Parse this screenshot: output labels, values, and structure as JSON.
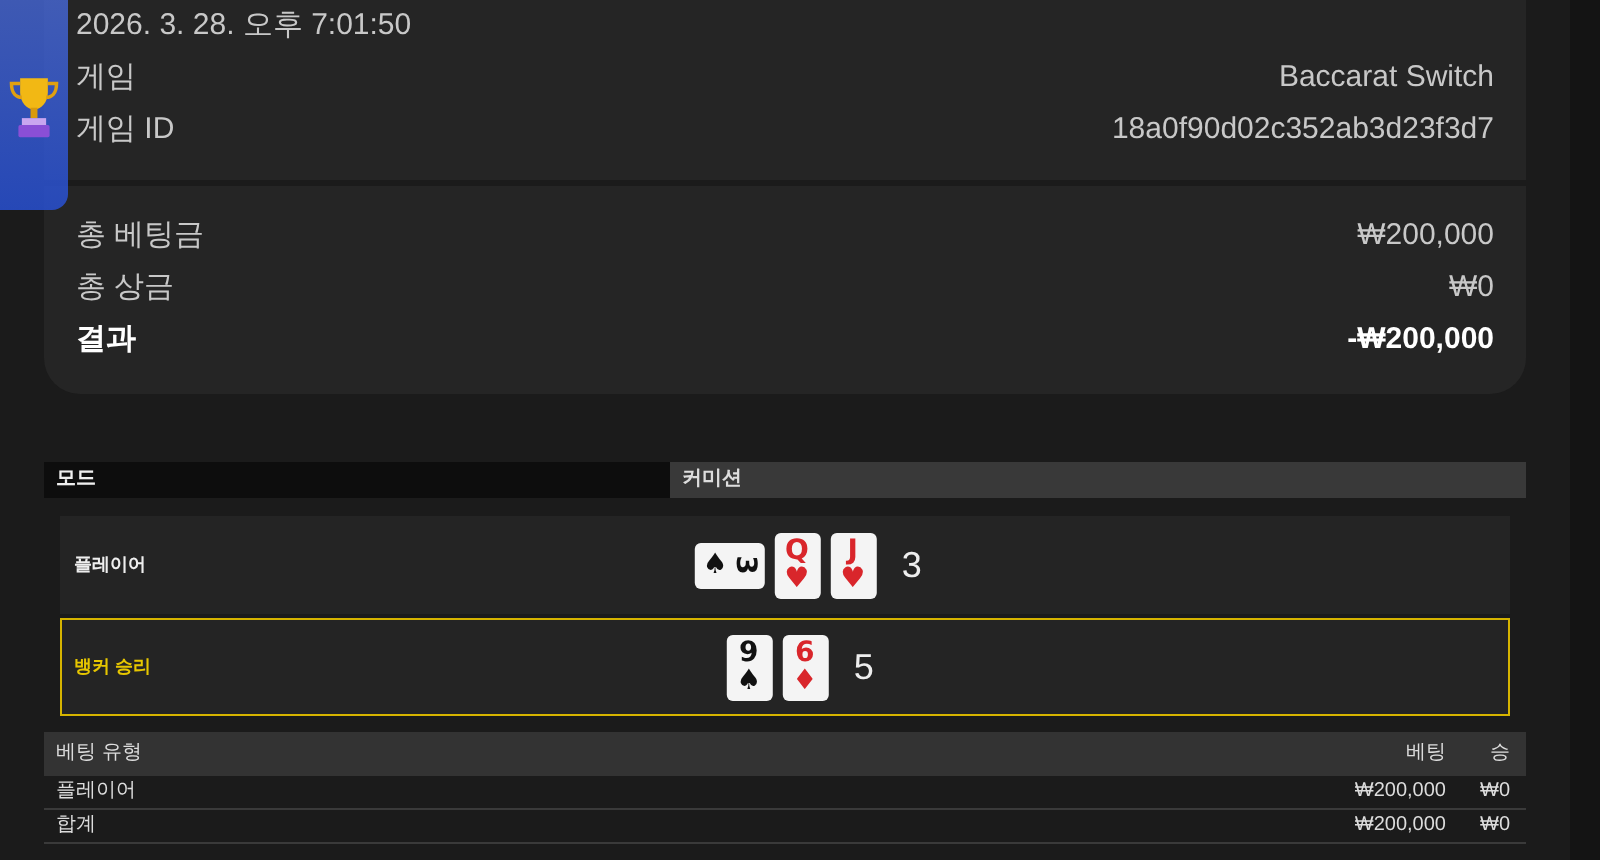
{
  "summary": {
    "datetime": "2026. 3. 28. 오후 7:01:50",
    "info": [
      {
        "label": "게임",
        "value": "Baccarat Switch"
      },
      {
        "label": "게임 ID",
        "value": "18a0f90d02c352ab3d23f3d7"
      }
    ],
    "totals": [
      {
        "label": "총 베팅금",
        "value": "₩200,000",
        "emphasis": false
      },
      {
        "label": "총 상금",
        "value": "₩0",
        "emphasis": false
      },
      {
        "label": "결과",
        "value": "-₩200,000",
        "emphasis": true
      }
    ]
  },
  "mode_bar": {
    "mode_label": "모드",
    "mode_value": "커미션"
  },
  "hands": [
    {
      "label": "플레이어",
      "winner": false,
      "score": "3",
      "cards": [
        {
          "rank": "3",
          "suit": "♠",
          "color": "#111111",
          "sideways": true
        },
        {
          "rank": "Q",
          "suit": "♥",
          "color": "#d9262b",
          "sideways": false
        },
        {
          "rank": "J",
          "suit": "♥",
          "color": "#d9262b",
          "sideways": false
        }
      ]
    },
    {
      "label": "뱅커 승리",
      "winner": true,
      "score": "5",
      "cards": [
        {
          "rank": "9",
          "suit": "♠",
          "color": "#111111",
          "sideways": false
        },
        {
          "rank": "6",
          "suit": "♦",
          "color": "#d9262b",
          "sideways": false
        }
      ]
    }
  ],
  "bets": {
    "columns": [
      "베팅 유형",
      "베팅",
      "승"
    ],
    "rows": [
      [
        "플레이어",
        "₩200,000",
        "₩0"
      ],
      [
        "합계",
        "₩200,000",
        "₩0"
      ]
    ]
  }
}
